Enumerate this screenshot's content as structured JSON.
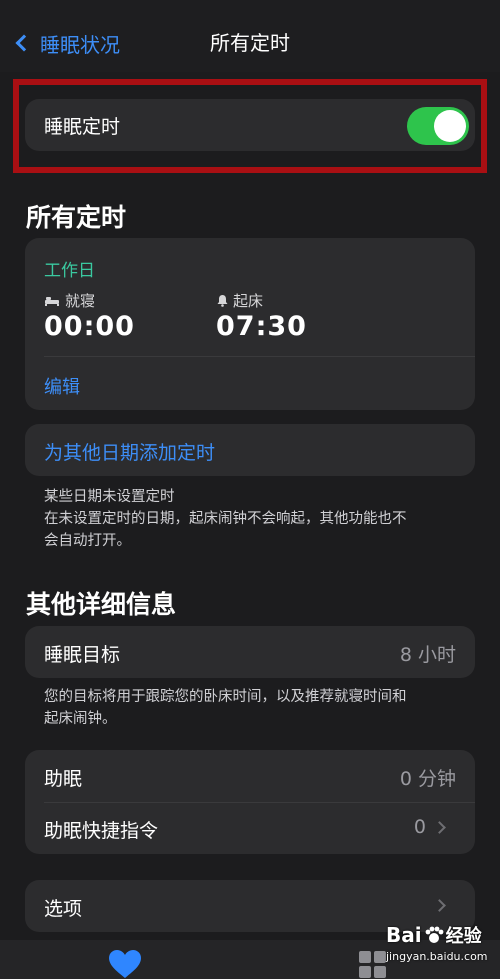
{
  "header": {
    "back_label": "睡眠状况",
    "title": "所有定时"
  },
  "sleep_schedule": {
    "label": "睡眠定时",
    "enabled": true
  },
  "all_schedules": {
    "title": "所有定时",
    "schedule": {
      "name": "工作日",
      "bedtime_label": "就寝",
      "bedtime": "00:00",
      "wake_label": "起床",
      "wake": "07:30",
      "edit_label": "编辑"
    },
    "add_label": "为其他日期添加定时",
    "note": [
      "某些日期未设置定时",
      "在未设置定时的日期，起床闹钟不会响起，其他功能也不",
      "会自动打开。"
    ]
  },
  "details": {
    "title": "其他详细信息",
    "goal": {
      "label": "睡眠目标",
      "value": "8 小时"
    },
    "goal_note": [
      "您的目标将用于跟踪您的卧床时间，以及推荐就寝时间和",
      "起床闹钟。"
    ],
    "wind_down": {
      "label": "助眠",
      "value": "0 分钟"
    },
    "shortcuts": {
      "label": "助眠快捷指令",
      "value": "0"
    },
    "options": {
      "label": "选项"
    }
  },
  "colors": {
    "accent_blue": "#3d8ef7",
    "toggle_on": "#2ec44c",
    "schedule_green": "#3ac9a0",
    "highlight_red": "#a90f13"
  },
  "watermark": {
    "brand_left": "Bai",
    "brand_right": "经验",
    "url": "jingyan.baidu.com"
  },
  "tabbar": {
    "icon": "heart-icon"
  }
}
